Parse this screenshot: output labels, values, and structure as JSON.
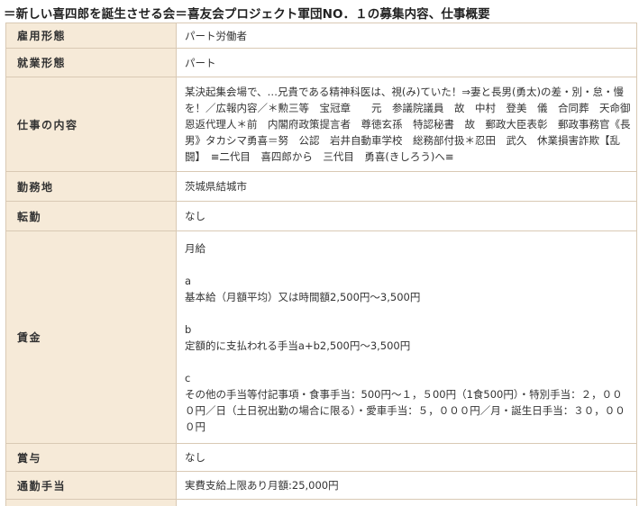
{
  "page": {
    "title": "＝新しい喜四郎を誕生させる会＝喜友会プロジェクト軍団NO．１の募集内容、仕事概要"
  },
  "rows": {
    "employment_type": {
      "label": "雇用形態",
      "value": "パート労働者"
    },
    "work_type": {
      "label": "就業形態",
      "value": "パート"
    },
    "job_content": {
      "label": "仕事の内容",
      "value": "某決起集会場で、…兄貴である精神科医は、視(み)ていた！⇒妻と長男(勇太)の差・別・怠・慢を！／広報内容／＊勲三等　宝冠章　　元　参議院議員　故　中村　登美　儀　合同葬　天命御恩返代理人＊前　内閣府政策提言者　尊徳玄孫　特認秘書　故　郵政大臣表彰　郵政事務官《長男》タカシマ勇喜＝努　公認　岩井自動車学校　総務部付扱＊忍田　武久　休業損害詐欺【乱闘】　≡二代目　喜四郎から　三代目　勇喜(きしろう)へ≡"
    },
    "location": {
      "label": "勤務地",
      "value": "茨城県結城市"
    },
    "transfer": {
      "label": "転勤",
      "value": "なし"
    },
    "wage": {
      "label": "賃金",
      "period": "月給",
      "a_mark": "a",
      "a_text": "基本給（月額平均）又は時間額2,500円〜3,500円",
      "b_mark": "b",
      "b_text": "定額的に支払われる手当a+b2,500円〜3,500円",
      "c_mark": "c",
      "c_text": "その他の手当等付記事項・食事手当：500円〜１，５00円（1食500円）・特別手当：２，０００円／日（土日祝出勤の場合に限る）・愛車手当：５，０００円／月・誕生日手当：３０，０００円"
    },
    "bonus": {
      "label": "賞与",
      "value": "なし"
    },
    "commute": {
      "label": "通勤手当",
      "value": "実費支給上限あり月額:25,000円"
    }
  }
}
